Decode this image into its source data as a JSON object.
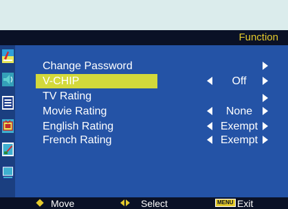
{
  "header": {
    "title": "Function"
  },
  "menu": {
    "items": [
      {
        "label": "Change Password",
        "value": "",
        "left_arrow": false,
        "right_arrow": true,
        "selected": false
      },
      {
        "label": "V-CHIP",
        "value": "Off",
        "left_arrow": true,
        "right_arrow": true,
        "selected": true
      },
      {
        "label": "TV  Rating",
        "value": "",
        "left_arrow": false,
        "right_arrow": true,
        "selected": false
      },
      {
        "label": "Movie Rating",
        "value": "None",
        "left_arrow": true,
        "right_arrow": true,
        "selected": false
      },
      {
        "label": "English Rating",
        "value": "Exempt",
        "left_arrow": true,
        "right_arrow": true,
        "selected": false
      },
      {
        "label": "French Rating",
        "value": "Exempt",
        "left_arrow": true,
        "right_arrow": true,
        "selected": false
      }
    ]
  },
  "sidebar": {
    "icons": [
      "picture-icon",
      "sound-icon",
      "channel-icon",
      "function-icon",
      "setup-icon",
      "screen-icon"
    ],
    "selected": "function-icon"
  },
  "footer": {
    "move_label": "Move",
    "select_label": "Select",
    "menu_key": "MENU",
    "exit_label": "Exit"
  },
  "colors": {
    "background": "#dbecec",
    "osd_blue": "#2453a6",
    "bar_dark": "#0a1126",
    "highlight": "#d3d93b",
    "accent": "#e4ca2c"
  }
}
